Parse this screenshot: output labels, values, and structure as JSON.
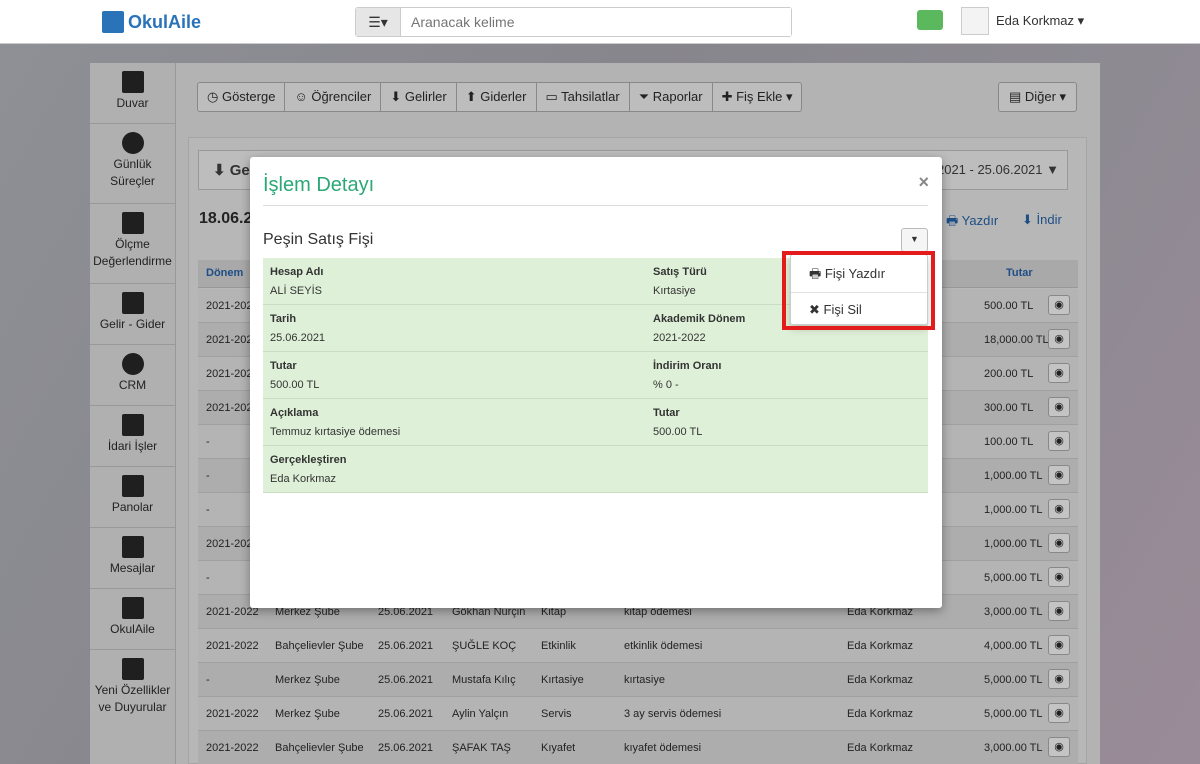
{
  "topbar": {
    "logo": "OkulAile",
    "search_placeholder": "Aranacak kelime",
    "user": "Eda Korkmaz"
  },
  "sidebar": {
    "items": [
      {
        "label": "Duvar",
        "icon": "wall-icon"
      },
      {
        "label": "Günlük Süreçler",
        "icon": "clock-icon"
      },
      {
        "label": "Ölçme Değerlendirme",
        "icon": "measure-icon"
      },
      {
        "label": "Gelir - Gider",
        "icon": "chart-icon"
      },
      {
        "label": "CRM",
        "icon": "crm-icon"
      },
      {
        "label": "İdari İşler",
        "icon": "briefcase-icon"
      },
      {
        "label": "Panolar",
        "icon": "calendar-icon"
      },
      {
        "label": "Mesajlar",
        "icon": "envelope-icon"
      },
      {
        "label": "OkulAile",
        "icon": "family-icon"
      },
      {
        "label": "Yeni Özellikler ve Duyurular",
        "icon": "megaphone-icon"
      }
    ]
  },
  "toolbar": {
    "items": [
      "Gösterge",
      "Öğrenciler",
      "Gelirler",
      "Giderler",
      "Tahsilatlar",
      "Raporlar",
      "Fiş Ekle"
    ],
    "other": "Diğer"
  },
  "page": {
    "heading_prefix": "Ge",
    "date_range": "06.2021 - 25.06.2021",
    "date": "18.06.2",
    "print": "Yazdır",
    "download": "İndir",
    "col_donem": "Dönem",
    "col_tutar": "Tutar"
  },
  "rows": [
    {
      "donem": "2021-202",
      "sube": "",
      "tarih": "",
      "ad": "",
      "tur": "",
      "aciklama": "",
      "kisi": "",
      "tutar": "500.00 TL"
    },
    {
      "donem": "2021-202",
      "sube": "",
      "tarih": "",
      "ad": "",
      "tur": "",
      "aciklama": "",
      "kisi": "",
      "tutar": "18,000.00 TL"
    },
    {
      "donem": "2021-202",
      "sube": "",
      "tarih": "",
      "ad": "",
      "tur": "",
      "aciklama": "",
      "kisi": "",
      "tutar": "200.00 TL"
    },
    {
      "donem": "2021-202",
      "sube": "",
      "tarih": "",
      "ad": "",
      "tur": "",
      "aciklama": "",
      "kisi": "",
      "tutar": "300.00 TL"
    },
    {
      "donem": "-",
      "sube": "",
      "tarih": "",
      "ad": "",
      "tur": "",
      "aciklama": "",
      "kisi": "",
      "tutar": "100.00 TL"
    },
    {
      "donem": "-",
      "sube": "",
      "tarih": "",
      "ad": "",
      "tur": "",
      "aciklama": "",
      "kisi": "",
      "tutar": "1,000.00 TL"
    },
    {
      "donem": "-",
      "sube": "",
      "tarih": "",
      "ad": "",
      "tur": "",
      "aciklama": "",
      "kisi": "",
      "tutar": "1,000.00 TL"
    },
    {
      "donem": "2021-202",
      "sube": "",
      "tarih": "",
      "ad": "",
      "tur": "",
      "aciklama": "",
      "kisi": "",
      "tutar": "1,000.00 TL"
    },
    {
      "donem": "-",
      "sube": "",
      "tarih": "",
      "ad": "",
      "tur": "",
      "aciklama": "",
      "kisi": "",
      "tutar": "5,000.00 TL"
    },
    {
      "donem": "2021-2022",
      "sube": "Merkez Şube",
      "tarih": "25.06.2021",
      "ad": "Gökhan Nurçin",
      "tur": "Kitap",
      "aciklama": "kitap ödemesi",
      "kisi": "Eda Korkmaz",
      "tutar": "3,000.00 TL"
    },
    {
      "donem": "2021-2022",
      "sube": "Bahçelievler Şube",
      "tarih": "25.06.2021",
      "ad": "ŞUĞLE KOÇ",
      "tur": "Etkinlik",
      "aciklama": "etkinlik ödemesi",
      "kisi": "Eda Korkmaz",
      "tutar": "4,000.00 TL"
    },
    {
      "donem": "-",
      "sube": "Merkez Şube",
      "tarih": "25.06.2021",
      "ad": "Mustafa Kılıç",
      "tur": "Kırtasiye",
      "aciklama": "kırtasiye",
      "kisi": "Eda Korkmaz",
      "tutar": "5,000.00 TL"
    },
    {
      "donem": "2021-2022",
      "sube": "Merkez Şube",
      "tarih": "25.06.2021",
      "ad": "Aylin Yalçın",
      "tur": "Servis",
      "aciklama": "3 ay servis ödemesi",
      "kisi": "Eda Korkmaz",
      "tutar": "5,000.00 TL"
    },
    {
      "donem": "2021-2022",
      "sube": "Bahçelievler Şube",
      "tarih": "25.06.2021",
      "ad": "ŞAFAK TAŞ",
      "tur": "Kıyafet",
      "aciklama": "kıyafet ödemesi",
      "kisi": "Eda Korkmaz",
      "tutar": "3,000.00 TL"
    }
  ],
  "modal": {
    "title": "İşlem Detayı",
    "close": "×",
    "subtitle": "Peşin Satış Fişi",
    "fields": [
      {
        "l": "Hesap Adı",
        "v": "ALİ SEYİS",
        "l2": "Satış Türü",
        "v2": "Kırtasiye"
      },
      {
        "l": "Tarih",
        "v": "25.06.2021",
        "l2": "Akademik Dönem",
        "v2": "2021-2022"
      },
      {
        "l": "Tutar",
        "v": "500.00 TL",
        "l2": "İndirim Oranı",
        "v2": "% 0 -"
      },
      {
        "l": "Açıklama",
        "v": "Temmuz kırtasiye ödemesi",
        "l2": "Tutar",
        "v2": "500.00 TL"
      },
      {
        "l": "Gerçekleştiren",
        "v": "Eda Korkmaz",
        "l2": "",
        "v2": ""
      }
    ],
    "menu": {
      "print": "Fişi Yazdır",
      "delete": "Fişi Sil"
    }
  }
}
